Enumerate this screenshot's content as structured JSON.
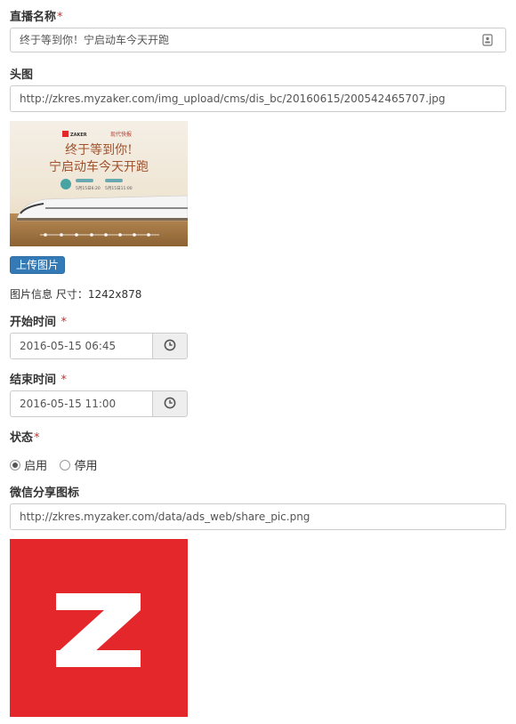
{
  "live_name": {
    "label": "直播名称",
    "required": "*",
    "value": "终于等到你！宁启动车今天开跑"
  },
  "head_image": {
    "label": "头图",
    "url": "http://zkres.myzaker.com/img_upload/cms/dis_bc/20160615/200542465707.jpg",
    "banner": {
      "brand": "ZAKER",
      "paper": "现代快报",
      "headline_1": "终于等到你!",
      "headline_2": "宁启动车今天开跑",
      "date_1": "5月15日6:20",
      "date_2": "5月15日11:00"
    },
    "upload_button": "上传图片",
    "info": "图片信息 尺寸：1242x878"
  },
  "start_time": {
    "label": "开始时间",
    "required": "*",
    "value": "2016-05-15 06:45"
  },
  "end_time": {
    "label": "结束时间",
    "required": "*",
    "value": "2016-05-15 11:00"
  },
  "status": {
    "label": "状态",
    "required": "*",
    "options": [
      "启用",
      "停用"
    ],
    "selected": "启用"
  },
  "share_icon": {
    "label": "微信分享图标",
    "url": "http://zkres.myzaker.com/data/ads_web/share_pic.png",
    "bg_color": "#e3272b"
  },
  "icons": {
    "field_addon": "contact-card-icon",
    "time_addon": "clock-icon"
  },
  "colors": {
    "required": "#c9302c",
    "button": "#337ab7",
    "zaker_red": "#e3272b"
  }
}
